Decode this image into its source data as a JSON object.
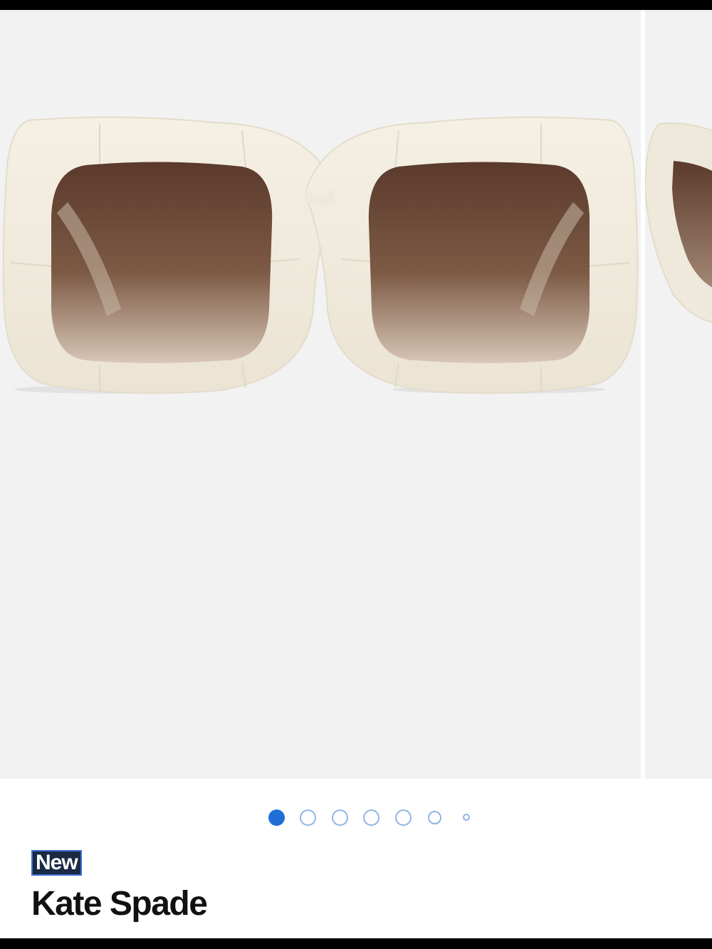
{
  "product": {
    "badge": "New",
    "brand": "Kate Spade"
  },
  "gallery": {
    "image_count": 7,
    "active_index": 0,
    "background_color": "#f2f2f2",
    "frame_color": "#efe9dc",
    "lens_color": "#6b4a3a"
  },
  "colors": {
    "accent": "#1f6fd6",
    "dot_inactive_border": "#8fb4e4",
    "badge_bg": "#1b2a44"
  }
}
